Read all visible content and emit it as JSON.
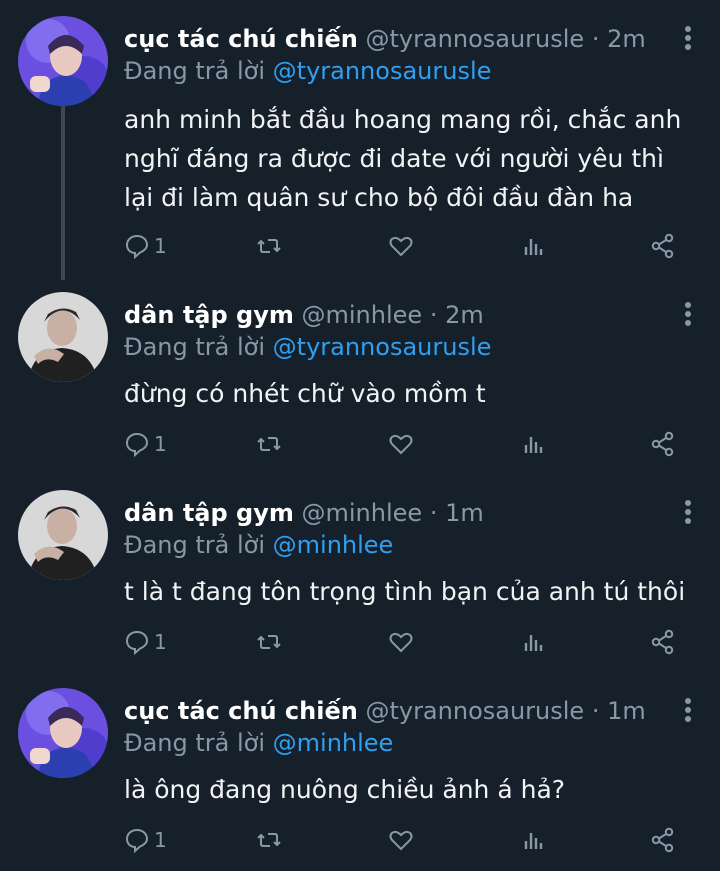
{
  "tweets": [
    {
      "name": "cục tác chú chiến",
      "handle": "@tyrannosaurusle",
      "sep": "·",
      "time": "2m",
      "reply_prefix": "Đang trả lời",
      "reply_to": "@tyrannosaurusle",
      "text": "anh minh bắt đầu hoang mang rồi, chắc anh nghĩ đáng ra được đi date với người yêu thì lại đi làm quân sư cho bộ đôi đầu đàn ha",
      "replies": "1",
      "avatar": "avatar-purple"
    },
    {
      "name": "dân tập gym",
      "handle": "@minhlee",
      "sep": "·",
      "time": "2m",
      "reply_prefix": "Đang trả lời",
      "reply_to": "@tyrannosaurusle",
      "text": "đừng có nhét chữ vào mồm t",
      "replies": "1",
      "avatar": "avatar-gray"
    },
    {
      "name": "dân tập gym",
      "handle": "@minhlee",
      "sep": "·",
      "time": "1m",
      "reply_prefix": "Đang trả lời",
      "reply_to": "@minhlee",
      "text": "t là t đang tôn trọng tình bạn của anh tú thôi",
      "replies": "1",
      "avatar": "avatar-gray"
    },
    {
      "name": "cục tác chú chiến",
      "handle": "@tyrannosaurusle",
      "sep": "·",
      "time": "1m",
      "reply_prefix": "Đang trả lời",
      "reply_to": "@minhlee",
      "text": "là ông đang nuông chiều ảnh á hả?",
      "replies": "1",
      "avatar": "avatar-purple"
    }
  ],
  "colors": {
    "background": "#16202b",
    "link": "#2f9ff0",
    "muted": "#8a97a6"
  }
}
